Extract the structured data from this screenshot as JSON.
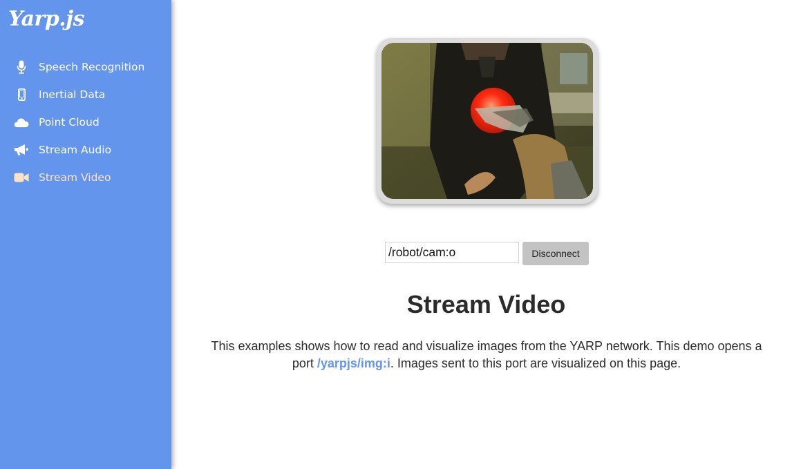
{
  "sidebar": {
    "logo": "Yarp.js",
    "items": [
      {
        "label": "Speech Recognition",
        "icon": "microphone-icon"
      },
      {
        "label": "Inertial Data",
        "icon": "mobile-phone-icon"
      },
      {
        "label": "Point Cloud",
        "icon": "cloud-icon"
      },
      {
        "label": "Stream Audio",
        "icon": "megaphone-icon"
      },
      {
        "label": "Stream Video",
        "icon": "video-camera-icon",
        "active": true
      }
    ]
  },
  "colors": {
    "sidebar_bg": "#6495ed",
    "active_item": "#fde3c0",
    "link": "#6495ed",
    "button_bg": "#c3c3c3",
    "text": "#2b2b2b"
  },
  "controls": {
    "port_value": "/robot/cam:o",
    "disconnect_label": "Disconnect"
  },
  "main": {
    "title": "Stream Video",
    "description_before": "This examples shows how to read and visualize images from the YARP network. This demo opens a port ",
    "port_name": "/yarpjs/img:i",
    "description_after": ". Images sent to this port are visualized on this page."
  }
}
